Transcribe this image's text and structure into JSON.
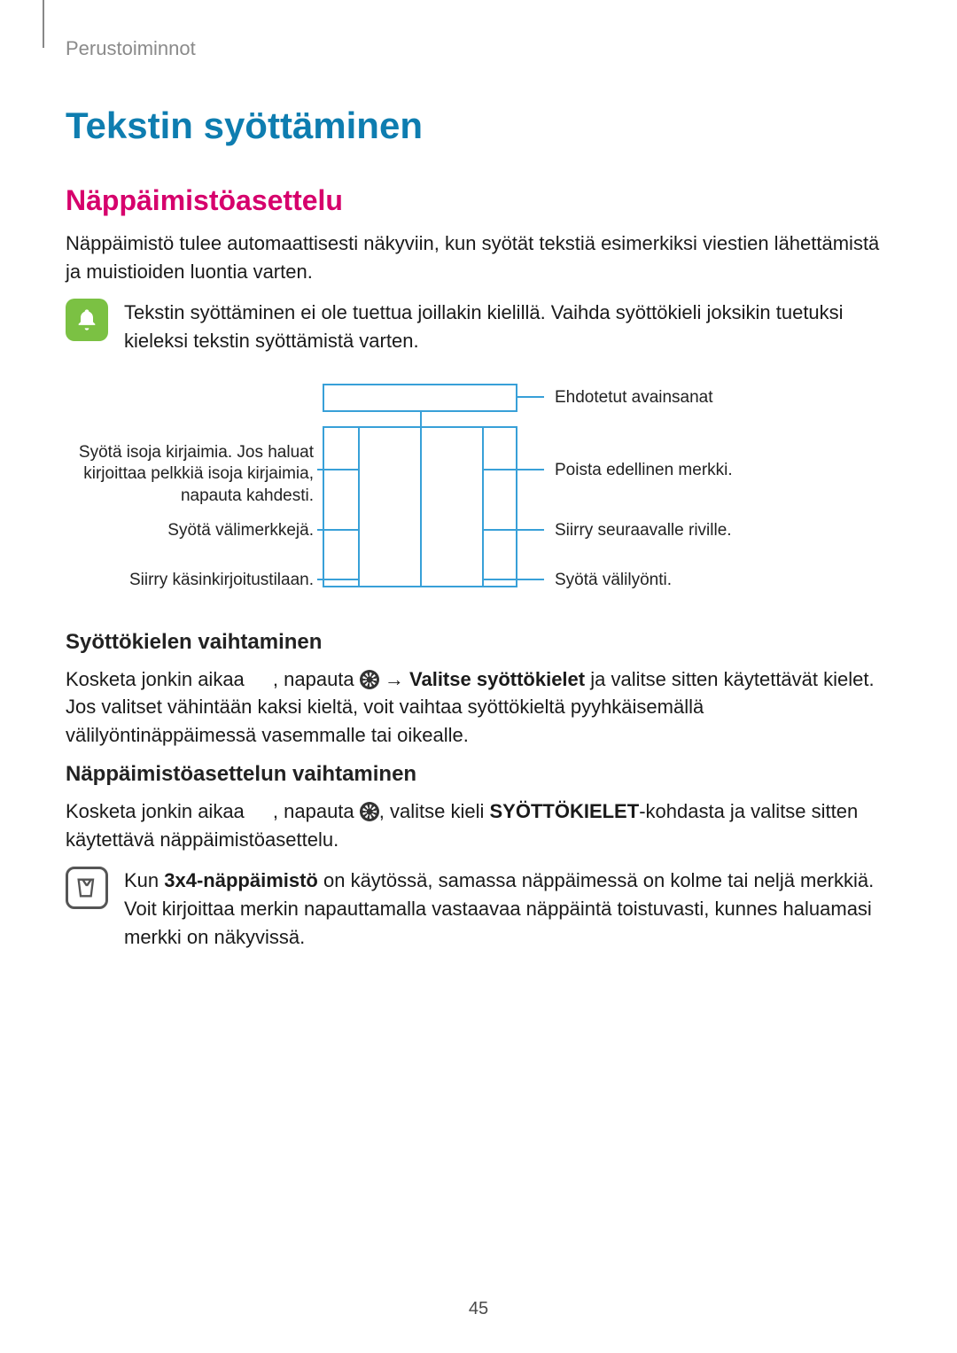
{
  "header": {
    "section": "Perustoiminnot"
  },
  "h1": "Tekstin syöttäminen",
  "h2": "Näppäimistöasettelu",
  "p_intro": "Näppäimistö tulee automaattisesti näkyviin, kun syötät tekstiä esimerkiksi viestien lähettämistä ja muistioiden luontia varten.",
  "note1": "Tekstin syöttäminen ei ole tuettua joillakin kielillä. Vaihda syöttökieli joksikin tuetuksi kieleksi tekstin syöttämistä varten.",
  "diagram": {
    "left": {
      "caps": "Syötä isoja kirjaimia. Jos haluat kirjoittaa pelkkiä isoja kirjaimia, napauta kahdesti.",
      "punct": "Syötä välimerkkejä.",
      "hand": "Siirry käsinkirjoitustilaan."
    },
    "right": {
      "suggested": "Ehdotetut avainsanat",
      "delete": "Poista edellinen merkki.",
      "newline": "Siirry seuraavalle riville.",
      "space": "Syötä välilyönti."
    }
  },
  "h3_lang": "Syöttökielen vaihtaminen",
  "p_lang_a": "Kosketa jonkin aikaa ",
  "p_lang_b": ", napauta ",
  "p_lang_c": " → ",
  "p_lang_bold": "Valitse syöttökielet",
  "p_lang_d": " ja valitse sitten käytettävät kielet. Jos valitset vähintään kaksi kieltä, voit vaihtaa syöttökieltä pyyhkäisemällä välilyöntinäppäimessä vasemmalle tai oikealle.",
  "h3_layout": "Näppäimistöasettelun vaihtaminen",
  "p_layout_a": "Kosketa jonkin aikaa ",
  "p_layout_b": ", napauta ",
  "p_layout_c": ", valitse kieli ",
  "p_layout_bold": "SYÖTTÖKIELET",
  "p_layout_d": "-kohdasta ja valitse sitten käytettävä näppäimistöasettelu.",
  "note2_a": "Kun ",
  "note2_bold": "3x4-näppäimistö",
  "note2_b": " on käytössä, samassa näppäimessä on kolme tai neljä merkkiä. Voit kirjoittaa merkin napauttamalla vastaavaa näppäintä toistuvasti, kunnes haluamasi merkki on näkyvissä.",
  "page_number": "45"
}
